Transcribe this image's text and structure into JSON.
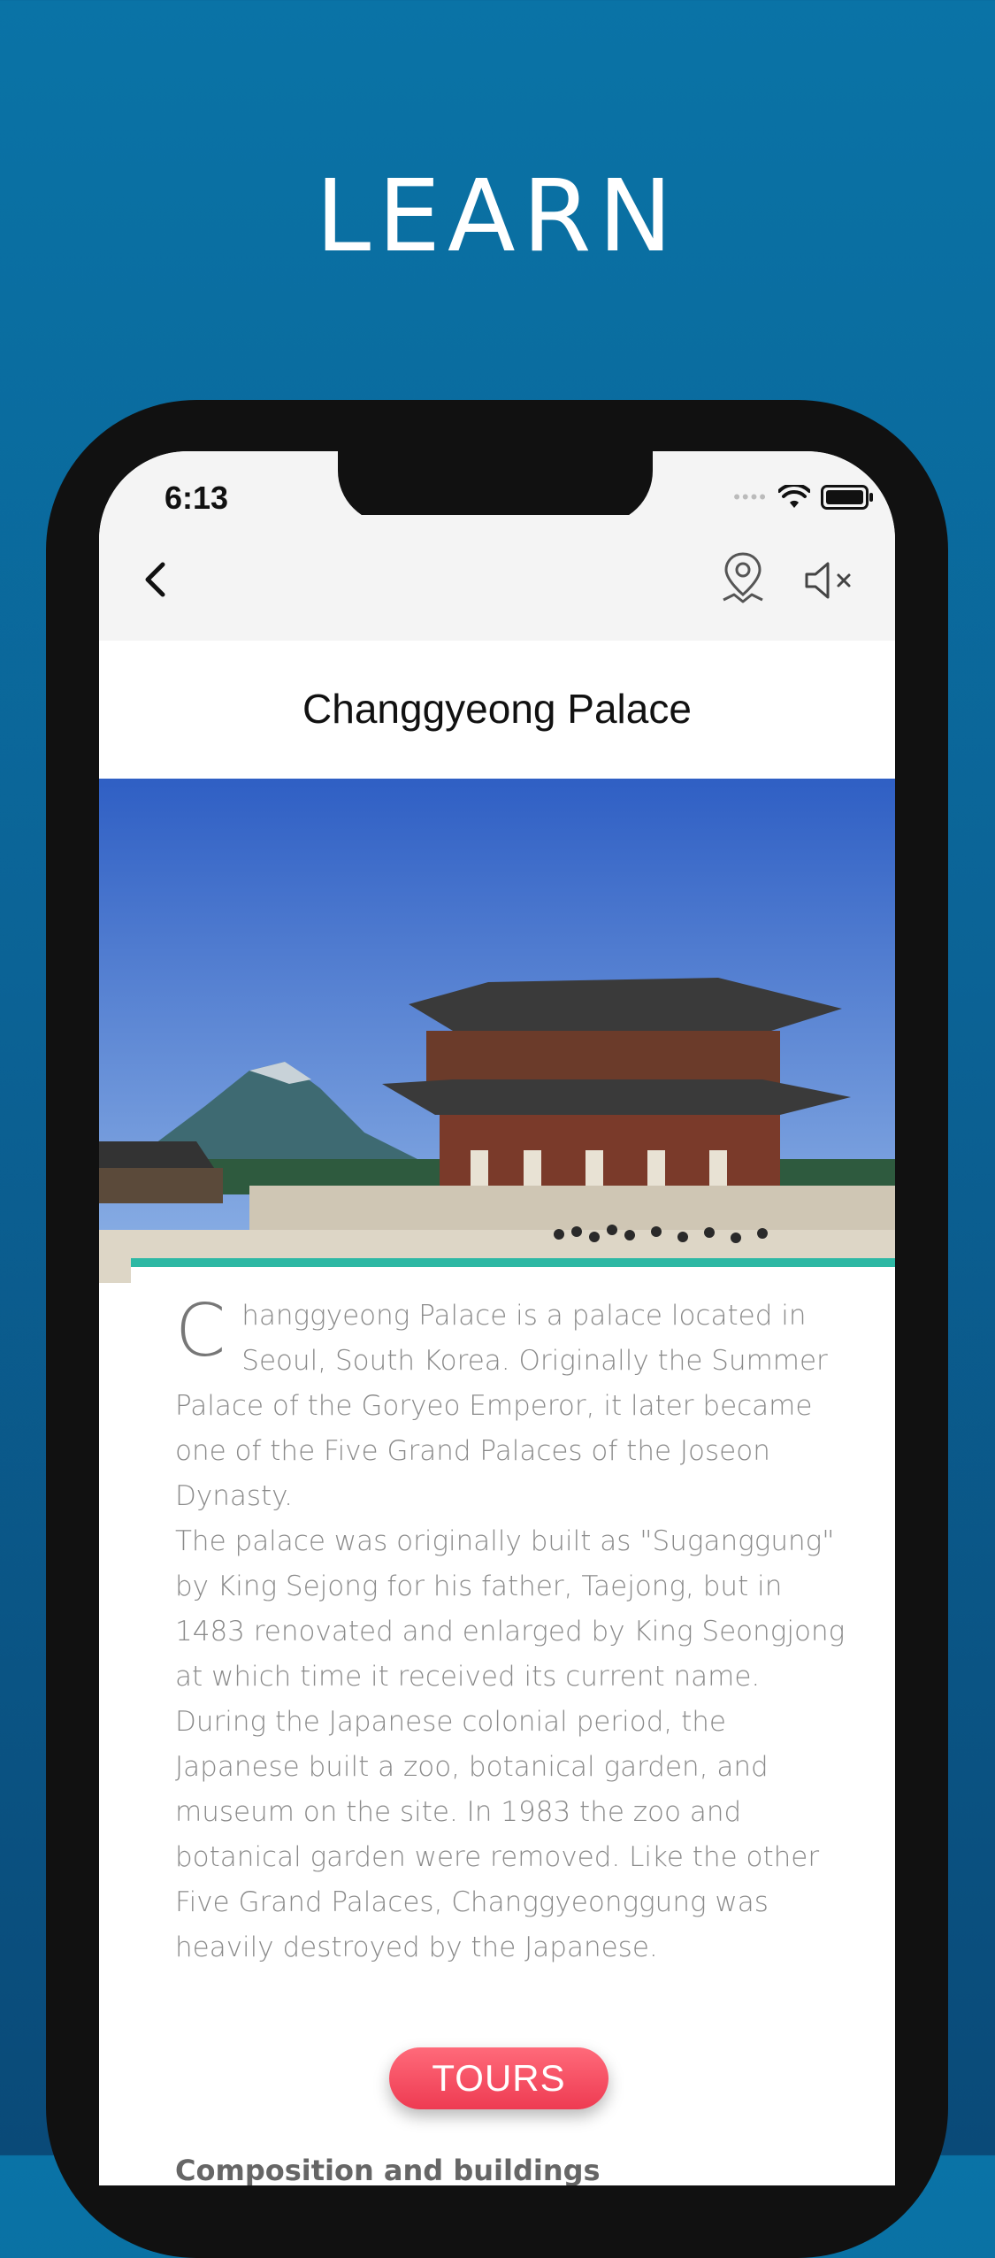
{
  "headline": "LEARN",
  "status_bar": {
    "time": "6:13",
    "icons": [
      "signal-icon",
      "wifi-icon",
      "battery-icon"
    ]
  },
  "nav_bar": {
    "back_icon": "chevron-left-icon",
    "map_icon": "map-pin-icon",
    "mute_icon": "speaker-muted-icon"
  },
  "page": {
    "title": "Changgyeong Palace"
  },
  "hero_image": {
    "subject": "palace-photo"
  },
  "article": {
    "dropcap": "C",
    "intro": "hanggyeong Palace is a palace located in Seoul, South Korea. Originally the Summer Palace of the Goryeo Emperor, it later became one of the Five Grand Palaces of the Joseon Dynasty.",
    "paragraph2": "The palace was originally built as \"Suganggung\" by King Sejong for his father, Taejong, but in 1483 renovated and enlarged by King Seongjong at which time it received its current name.",
    "paragraph3": "During the Japanese colonial period, the Japanese built a zoo, botanical garden, and museum on the site. In 1983 the zoo and botanical garden were removed. Like the other Five Grand Palaces, Changgyeonggung was heavily destroyed by the Japanese.",
    "section_heading": "Composition and buildings"
  },
  "tours_button": {
    "label": "TOURS"
  },
  "colors": {
    "background": "#0a6a9e",
    "accent": "#2db8a4",
    "tours": "#ee3b52"
  }
}
